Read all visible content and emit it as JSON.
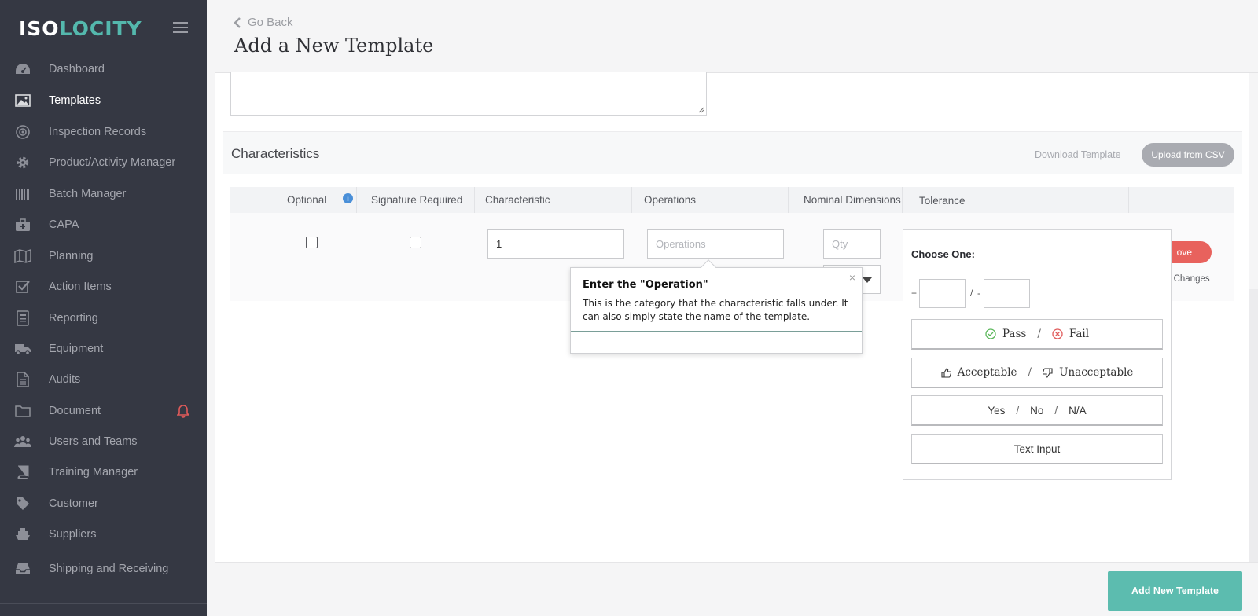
{
  "sidebar": {
    "logo_a": "ISO",
    "logo_b": "LOCITY",
    "items": [
      {
        "label": "Dashboard",
        "icon": "dashboard-icon"
      },
      {
        "label": "Templates",
        "icon": "image-icon"
      },
      {
        "label": "Inspection Records",
        "icon": "target-icon"
      },
      {
        "label": "Product/Activity Manager",
        "icon": "gear-icon"
      },
      {
        "label": "Batch Manager",
        "icon": "barcode-icon"
      },
      {
        "label": "CAPA",
        "icon": "first-aid-icon"
      },
      {
        "label": "Planning",
        "icon": "map-icon"
      },
      {
        "label": "Action Items",
        "icon": "checkbox-icon"
      },
      {
        "label": "Reporting",
        "icon": "report-icon"
      },
      {
        "label": "Equipment",
        "icon": "truck-icon"
      },
      {
        "label": "Audits",
        "icon": "file-icon"
      },
      {
        "label": "Document",
        "icon": "folder-icon"
      },
      {
        "label": "Users and Teams",
        "icon": "users-icon"
      },
      {
        "label": "Training Manager",
        "icon": "book-icon"
      },
      {
        "label": "Customer",
        "icon": "tag-icon"
      },
      {
        "label": "Suppliers",
        "icon": "ship-icon"
      },
      {
        "label": "Shipping and Receiving",
        "icon": "inbox-icon"
      }
    ],
    "active_color": "#ffffff",
    "bell_color": "#e05a5a"
  },
  "header": {
    "go_back": "Go Back",
    "title": "Add a New Template"
  },
  "characteristics": {
    "title": "Characteristics",
    "download_link": "Download Template",
    "upload_button": "Upload from CSV",
    "columns": [
      "Optional",
      "Signature Required",
      "Characteristic",
      "Operations",
      "Nominal Dimensions",
      "Tolerance"
    ],
    "row": {
      "characteristic_value": "1",
      "operations_placeholder": "Operations",
      "qty_placeholder": "Qty",
      "remove_label": "ove",
      "unsaved_label": "d Changes"
    }
  },
  "tolerance": {
    "title": "Choose One:",
    "plus": "+",
    "slash": "/",
    "minus": "-",
    "pass": "Pass",
    "fail": "Fail",
    "acceptable": "Acceptable",
    "unacceptable": "Unacceptable",
    "yes": "Yes",
    "no": "No",
    "na": "N/A",
    "text_input": "Text Input"
  },
  "tooltip": {
    "title": "Enter the \"Operation\"",
    "body": "This is the category that the characteristic falls under. It can also simply state the name of the template.",
    "close": "×"
  },
  "footer": {
    "add_button": "Add New Template"
  },
  "colors": {
    "accent": "#5cbcaf",
    "remove": "#e8625d",
    "sidebar_bg": "#353843"
  }
}
